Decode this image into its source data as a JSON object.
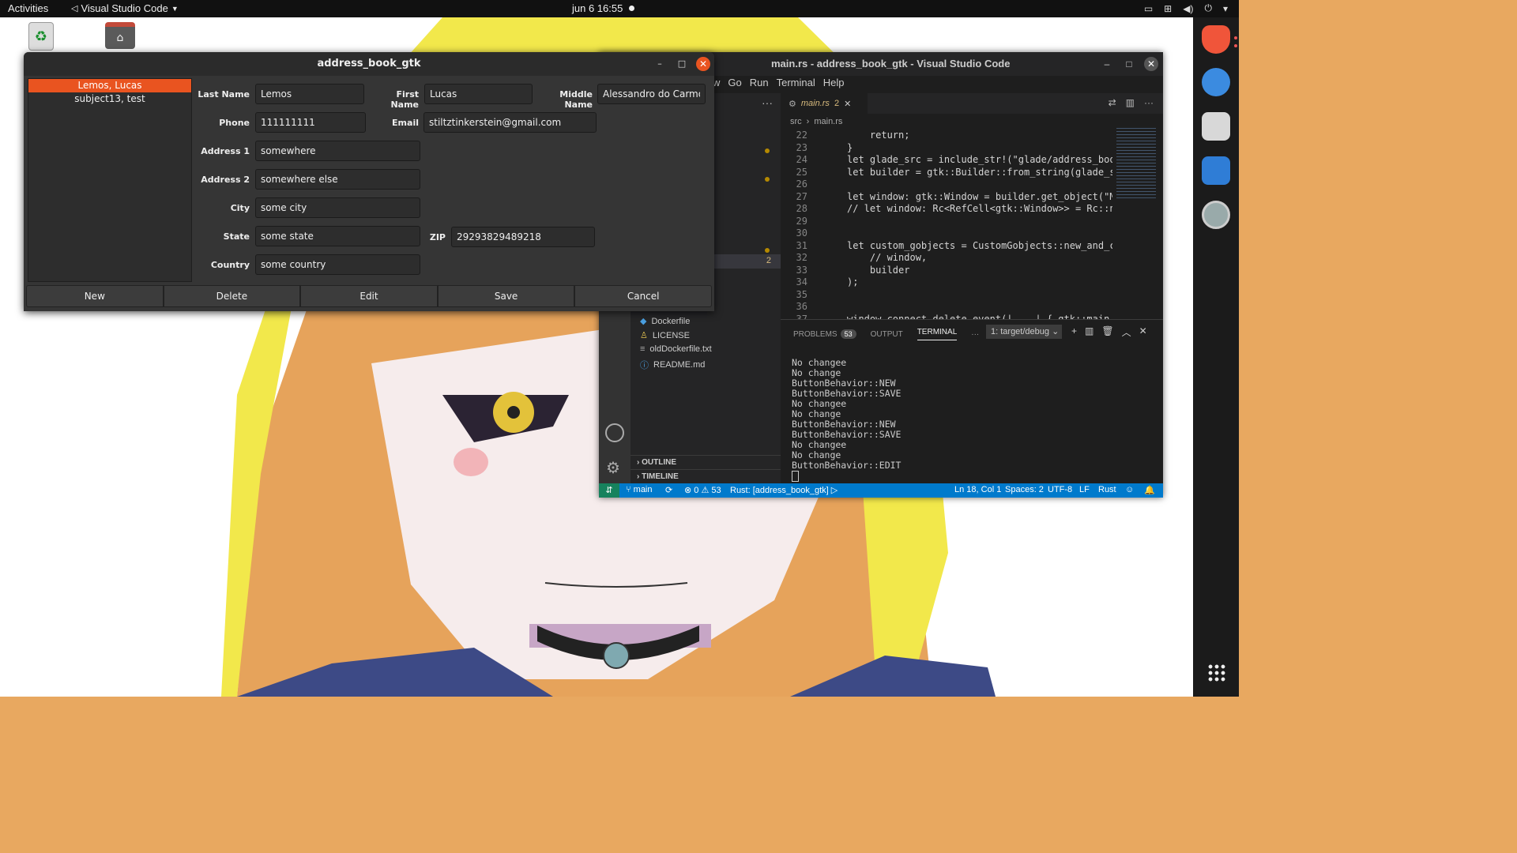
{
  "topbar": {
    "activities": "Activities",
    "app_name": "Visual Studio Code",
    "clock": "jun 6  16:55"
  },
  "gtk": {
    "title": "address_book_gtk",
    "contacts": [
      "Lemos, Lucas",
      "subject13, test"
    ],
    "fields": {
      "last_name": {
        "label": "Last Name",
        "value": "Lemos"
      },
      "first_name": {
        "label": "First Name",
        "value": "Lucas"
      },
      "middle_name": {
        "label": "Middle Name",
        "value": "Alessandro do Carmo"
      },
      "phone": {
        "label": "Phone",
        "value": "111111111"
      },
      "email": {
        "label": "Email",
        "value": "stiltztinkerstein@gmail.com"
      },
      "address1": {
        "label": "Address 1",
        "value": "somewhere"
      },
      "address2": {
        "label": "Address 2",
        "value": "somewhere else"
      },
      "city": {
        "label": "City",
        "value": "some city"
      },
      "state": {
        "label": "State",
        "value": "some state"
      },
      "zip": {
        "label": "ZIP",
        "value": "29293829489218"
      },
      "country": {
        "label": "Country",
        "value": "some country"
      }
    },
    "buttons": {
      "new": "New",
      "delete": "Delete",
      "edit": "Edit",
      "save": "Save",
      "cancel": "Cancel"
    }
  },
  "vscode": {
    "title": "main.rs - address_book_gtk - Visual Studio Code",
    "menu": [
      "w",
      "Go",
      "Run",
      "Terminal",
      "Help"
    ],
    "tab": {
      "name": "main.rs",
      "problems": "2"
    },
    "breadcrumb": [
      "src",
      "main.rs"
    ],
    "sidebar_badge": "2",
    "files": [
      "Dockerfile",
      "LICENSE",
      "oldDockerfile.txt",
      "README.md"
    ],
    "sections": {
      "outline": "OUTLINE",
      "timeline": "TIMELINE"
    },
    "code": [
      {
        "ln": "22",
        "text": "    return;"
      },
      {
        "ln": "23",
        "text": "}"
      },
      {
        "ln": "24",
        "text": "let glade_src = include_str!(\"glade/address_book."
      },
      {
        "ln": "25",
        "text": "let builder = gtk::Builder::from_string(glade_src"
      },
      {
        "ln": "26",
        "text": ""
      },
      {
        "ln": "27",
        "text": "let window: gtk::Window = builder.get_object(\"Mai"
      },
      {
        "ln": "28",
        "text": "// let window: Rc<RefCell<gtk::Window>> = Rc::new"
      },
      {
        "ln": "29",
        "text": ""
      },
      {
        "ln": "30",
        "text": ""
      },
      {
        "ln": "31",
        "text": "let custom_gobjects = CustomGobjects::new_and_con"
      },
      {
        "ln": "32",
        "text": "    // window,"
      },
      {
        "ln": "33",
        "text": "    builder"
      },
      {
        "ln": "34",
        "text": ");"
      },
      {
        "ln": "35",
        "text": ""
      },
      {
        "ln": "36",
        "text": ""
      },
      {
        "ln": "37",
        "text": "window.connect_delete_event(|_, _| { gtk::main_qu"
      }
    ],
    "panel": {
      "problems": "PROBLEMS",
      "problems_count": "53",
      "output": "OUTPUT",
      "terminal": "TERMINAL",
      "terminal_select": "1: target/debug"
    },
    "terminal_lines": [
      "No changee",
      "No change",
      "ButtonBehavior::NEW",
      "ButtonBehavior::SAVE",
      "No changee",
      "No change",
      "ButtonBehavior::NEW",
      "ButtonBehavior::SAVE",
      "No changee",
      "No change",
      "ButtonBehavior::EDIT"
    ],
    "status": {
      "branch": "main",
      "errors": "0",
      "warnings": "53",
      "rust": "Rust: [address_book_gtk]",
      "position": "Ln 18, Col 1",
      "spaces": "Spaces: 2",
      "encoding": "UTF-8",
      "eol": "LF",
      "language": "Rust"
    }
  }
}
